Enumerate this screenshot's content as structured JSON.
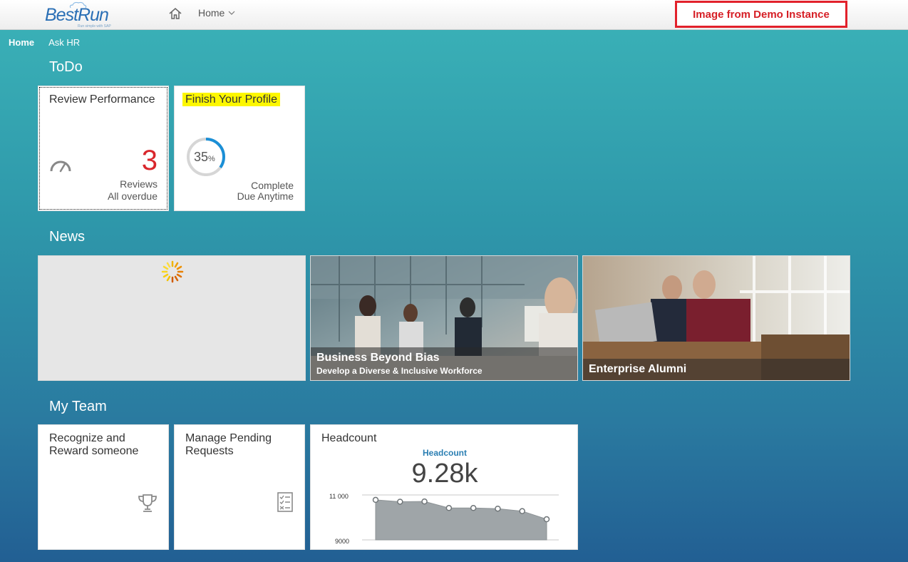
{
  "header": {
    "logo_text": "BestRun",
    "logo_tagline": "Run simple with SAP",
    "home_menu_label": "Home",
    "demo_badge": "Image from Demo Instance"
  },
  "subnav": {
    "items": [
      "Home",
      "Ask HR"
    ]
  },
  "sections": {
    "todo": "ToDo",
    "news": "News",
    "my_team": "My Team"
  },
  "todo": {
    "review": {
      "title": "Review Performance",
      "count": "3",
      "line1": "Reviews",
      "line2": "All overdue"
    },
    "profile": {
      "title": "Finish Your Profile",
      "percent": "35",
      "percent_unit": "%",
      "progress": 0.35,
      "line1": "Complete",
      "line2": "Due Anytime"
    }
  },
  "news": {
    "item2": {
      "title": "Business Beyond Bias",
      "subtitle": "Develop a Diverse & Inclusive Workforce"
    },
    "item3": {
      "title": "Enterprise Alumni"
    }
  },
  "team": {
    "recognize": {
      "title_line1": "Recognize and",
      "title_line2": "Reward someone"
    },
    "pending": {
      "title_line1": "Manage Pending",
      "title_line2": "Requests"
    },
    "headcount": {
      "title": "Headcount",
      "chart_label": "Headcount",
      "value": "9.28k"
    }
  },
  "chart_data": {
    "type": "area",
    "title": "Headcount",
    "y_ticks": [
      "11 000",
      "9000"
    ],
    "ylim": [
      9000,
      11000
    ],
    "x": [
      1,
      2,
      3,
      4,
      5,
      6,
      7,
      8
    ],
    "values": [
      10780,
      10700,
      10710,
      10420,
      10420,
      10390,
      10280,
      9920
    ],
    "colors": {
      "fill": "#9fa5a8",
      "line": "#8d9396",
      "marker": "#ffffff"
    }
  },
  "colors": {
    "accent_red": "#d9262c",
    "teal": "#3bb3b8",
    "blue": "#1b8fd6",
    "highlight": "#fdf700"
  }
}
